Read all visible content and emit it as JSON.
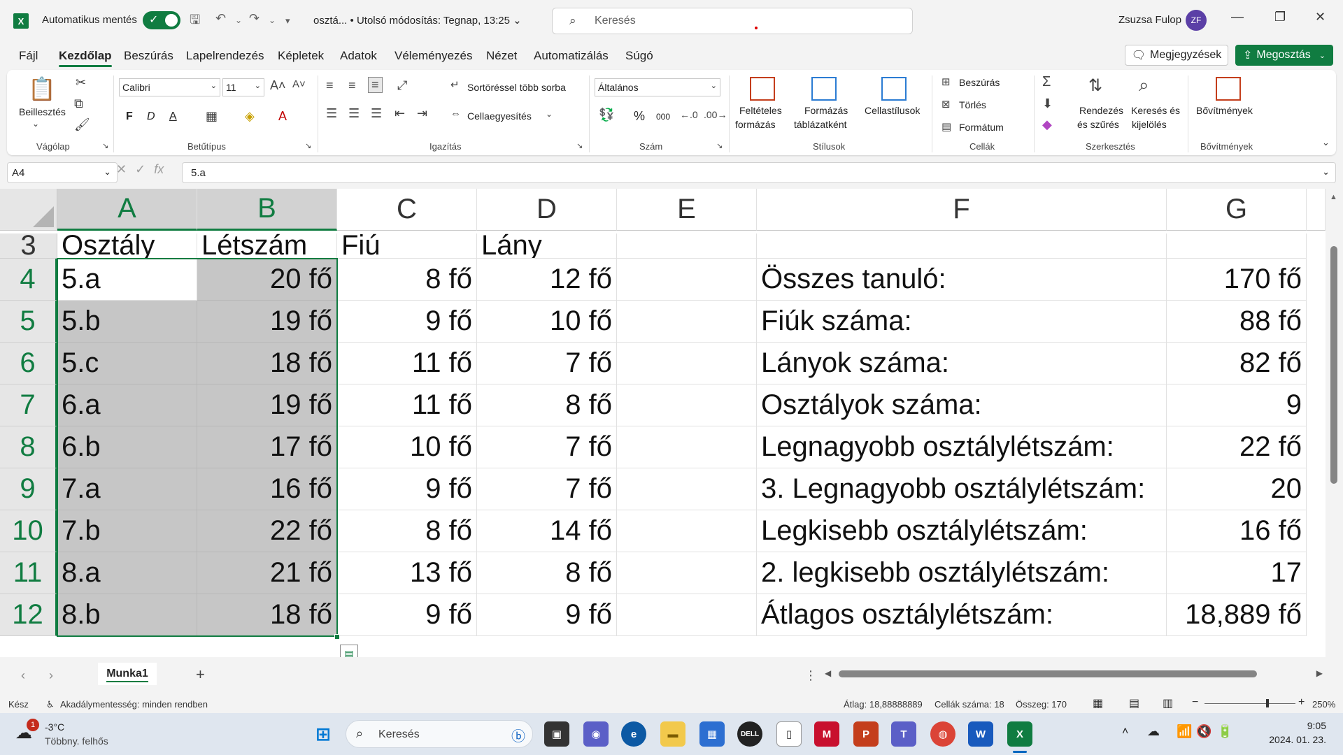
{
  "titlebar": {
    "autosave_label": "Automatikus mentés",
    "doc_title": "osztá... • Utolsó módosítás: Tegnap, 13:25 ⌄",
    "search_placeholder": "Keresés",
    "user_name": "Zsuzsa Fulop",
    "user_initials": "ZF",
    "app_letter": "X"
  },
  "menu": {
    "tabs": [
      "Fájl",
      "Kezdőlap",
      "Beszúrás",
      "Lapelrendezés",
      "Képletek",
      "Adatok",
      "Véleményezés",
      "Nézet",
      "Automatizálás",
      "Súgó"
    ],
    "active_tab": "Kezdőlap",
    "comments_label": "Megjegyzések",
    "share_label": "Megosztás"
  },
  "ribbon": {
    "clipboard": {
      "paste_label": "Beillesztés",
      "group_label": "Vágólap"
    },
    "font": {
      "font_name": "Calibri",
      "font_size": "11",
      "bold": "F",
      "italic": "D",
      "underline": "A",
      "group_label": "Betűtípus"
    },
    "alignment": {
      "wrap_label": "Sortöréssel több sorba",
      "merge_label": "Cellaegyesítés",
      "group_label": "Igazítás"
    },
    "number": {
      "format": "Általános",
      "group_label": "Szám",
      "percent": "%",
      "thousands": "000"
    },
    "styles": {
      "conditional_label_1": "Feltételes",
      "conditional_label_2": "formázás",
      "table_label_1": "Formázás",
      "table_label_2": "táblázatként",
      "cell_styles_label": "Cellastílusok",
      "group_label": "Stílusok"
    },
    "cells": {
      "insert_label": "Beszúrás",
      "delete_label": "Törlés",
      "format_label": "Formátum",
      "group_label": "Cellák"
    },
    "editing": {
      "sort_label_1": "Rendezés",
      "sort_label_2": "és szűrés",
      "find_label_1": "Keresés és",
      "find_label_2": "kijelölés",
      "group_label": "Szerkesztés"
    },
    "addins": {
      "label": "Bővítmények",
      "group_label": "Bővítmények"
    }
  },
  "formula_bar": {
    "name_box": "A4",
    "fx": "fx",
    "formula": "5.a"
  },
  "sheet": {
    "columns": [
      "A",
      "B",
      "C",
      "D",
      "E",
      "F",
      "G"
    ],
    "selected_columns": [
      "A",
      "B"
    ],
    "rows": [
      {
        "num": "3",
        "A": "Osztály",
        "B": "Létszám",
        "C": "Fiú",
        "D": "Lány",
        "F": "",
        "G": ""
      },
      {
        "num": "4",
        "A": "5.a",
        "B": "20 fő",
        "C": "8 fő",
        "D": "12 fő",
        "F": "Összes tanuló:",
        "G": "170 fő"
      },
      {
        "num": "5",
        "A": "5.b",
        "B": "19 fő",
        "C": "9 fő",
        "D": "10 fő",
        "F": "Fiúk száma:",
        "G": "88 fő"
      },
      {
        "num": "6",
        "A": "5.c",
        "B": "18 fő",
        "C": "11 fő",
        "D": "7 fő",
        "F": "Lányok száma:",
        "G": "82 fő"
      },
      {
        "num": "7",
        "A": "6.a",
        "B": "19 fő",
        "C": "11 fő",
        "D": "8 fő",
        "F": "Osztályok száma:",
        "G": "9"
      },
      {
        "num": "8",
        "A": "6.b",
        "B": "17 fő",
        "C": "10 fő",
        "D": "7 fő",
        "F": "Legnagyobb osztálylétszám:",
        "G": "22 fő"
      },
      {
        "num": "9",
        "A": "7.a",
        "B": "16 fő",
        "C": "9 fő",
        "D": "7 fő",
        "F": "3. Legnagyobb osztálylétszám:",
        "G": "20"
      },
      {
        "num": "10",
        "A": "7.b",
        "B": "22 fő",
        "C": "8 fő",
        "D": "14 fő",
        "F": "Legkisebb osztálylétszám:",
        "G": "16 fő"
      },
      {
        "num": "11",
        "A": "8.a",
        "B": "21 fő",
        "C": "13 fő",
        "D": "8 fő",
        "F": "2. legkisebb osztálylétszám:",
        "G": "17"
      },
      {
        "num": "12",
        "A": "8.b",
        "B": "18 fő",
        "C": "9 fő",
        "D": "9 fő",
        "F": "Átlagos osztálylétszám:",
        "G": "18,889 fő"
      }
    ]
  },
  "sheet_tabs": {
    "active": "Munka1",
    "add": "+"
  },
  "status_bar": {
    "ready": "Kész",
    "accessibility": "Akadálymentesség: minden rendben",
    "average": "Átlag: 18,88888889",
    "count": "Cellák száma: 18",
    "sum": "Összeg: 170",
    "zoom": "250%"
  },
  "taskbar": {
    "weather_temp": "-3°C",
    "weather_desc": "Többny. felhős",
    "weather_badge": "1",
    "search_label": "Keresés",
    "time": "9:05",
    "date": "2024. 01. 23."
  },
  "colors": {
    "accent": "#107c41",
    "selection": "#c6c6c6"
  }
}
